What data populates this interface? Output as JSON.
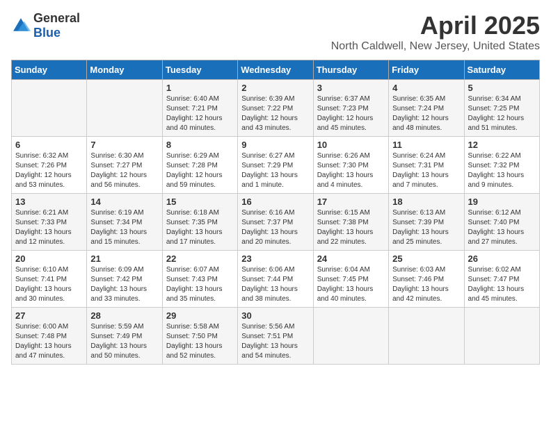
{
  "logo": {
    "general": "General",
    "blue": "Blue"
  },
  "title": {
    "month": "April 2025",
    "location": "North Caldwell, New Jersey, United States"
  },
  "weekdays": [
    "Sunday",
    "Monday",
    "Tuesday",
    "Wednesday",
    "Thursday",
    "Friday",
    "Saturday"
  ],
  "weeks": [
    [
      {
        "day": "",
        "sunrise": "",
        "sunset": "",
        "daylight": ""
      },
      {
        "day": "",
        "sunrise": "",
        "sunset": "",
        "daylight": ""
      },
      {
        "day": "1",
        "sunrise": "Sunrise: 6:40 AM",
        "sunset": "Sunset: 7:21 PM",
        "daylight": "Daylight: 12 hours and 40 minutes."
      },
      {
        "day": "2",
        "sunrise": "Sunrise: 6:39 AM",
        "sunset": "Sunset: 7:22 PM",
        "daylight": "Daylight: 12 hours and 43 minutes."
      },
      {
        "day": "3",
        "sunrise": "Sunrise: 6:37 AM",
        "sunset": "Sunset: 7:23 PM",
        "daylight": "Daylight: 12 hours and 45 minutes."
      },
      {
        "day": "4",
        "sunrise": "Sunrise: 6:35 AM",
        "sunset": "Sunset: 7:24 PM",
        "daylight": "Daylight: 12 hours and 48 minutes."
      },
      {
        "day": "5",
        "sunrise": "Sunrise: 6:34 AM",
        "sunset": "Sunset: 7:25 PM",
        "daylight": "Daylight: 12 hours and 51 minutes."
      }
    ],
    [
      {
        "day": "6",
        "sunrise": "Sunrise: 6:32 AM",
        "sunset": "Sunset: 7:26 PM",
        "daylight": "Daylight: 12 hours and 53 minutes."
      },
      {
        "day": "7",
        "sunrise": "Sunrise: 6:30 AM",
        "sunset": "Sunset: 7:27 PM",
        "daylight": "Daylight: 12 hours and 56 minutes."
      },
      {
        "day": "8",
        "sunrise": "Sunrise: 6:29 AM",
        "sunset": "Sunset: 7:28 PM",
        "daylight": "Daylight: 12 hours and 59 minutes."
      },
      {
        "day": "9",
        "sunrise": "Sunrise: 6:27 AM",
        "sunset": "Sunset: 7:29 PM",
        "daylight": "Daylight: 13 hours and 1 minute."
      },
      {
        "day": "10",
        "sunrise": "Sunrise: 6:26 AM",
        "sunset": "Sunset: 7:30 PM",
        "daylight": "Daylight: 13 hours and 4 minutes."
      },
      {
        "day": "11",
        "sunrise": "Sunrise: 6:24 AM",
        "sunset": "Sunset: 7:31 PM",
        "daylight": "Daylight: 13 hours and 7 minutes."
      },
      {
        "day": "12",
        "sunrise": "Sunrise: 6:22 AM",
        "sunset": "Sunset: 7:32 PM",
        "daylight": "Daylight: 13 hours and 9 minutes."
      }
    ],
    [
      {
        "day": "13",
        "sunrise": "Sunrise: 6:21 AM",
        "sunset": "Sunset: 7:33 PM",
        "daylight": "Daylight: 13 hours and 12 minutes."
      },
      {
        "day": "14",
        "sunrise": "Sunrise: 6:19 AM",
        "sunset": "Sunset: 7:34 PM",
        "daylight": "Daylight: 13 hours and 15 minutes."
      },
      {
        "day": "15",
        "sunrise": "Sunrise: 6:18 AM",
        "sunset": "Sunset: 7:35 PM",
        "daylight": "Daylight: 13 hours and 17 minutes."
      },
      {
        "day": "16",
        "sunrise": "Sunrise: 6:16 AM",
        "sunset": "Sunset: 7:37 PM",
        "daylight": "Daylight: 13 hours and 20 minutes."
      },
      {
        "day": "17",
        "sunrise": "Sunrise: 6:15 AM",
        "sunset": "Sunset: 7:38 PM",
        "daylight": "Daylight: 13 hours and 22 minutes."
      },
      {
        "day": "18",
        "sunrise": "Sunrise: 6:13 AM",
        "sunset": "Sunset: 7:39 PM",
        "daylight": "Daylight: 13 hours and 25 minutes."
      },
      {
        "day": "19",
        "sunrise": "Sunrise: 6:12 AM",
        "sunset": "Sunset: 7:40 PM",
        "daylight": "Daylight: 13 hours and 27 minutes."
      }
    ],
    [
      {
        "day": "20",
        "sunrise": "Sunrise: 6:10 AM",
        "sunset": "Sunset: 7:41 PM",
        "daylight": "Daylight: 13 hours and 30 minutes."
      },
      {
        "day": "21",
        "sunrise": "Sunrise: 6:09 AM",
        "sunset": "Sunset: 7:42 PM",
        "daylight": "Daylight: 13 hours and 33 minutes."
      },
      {
        "day": "22",
        "sunrise": "Sunrise: 6:07 AM",
        "sunset": "Sunset: 7:43 PM",
        "daylight": "Daylight: 13 hours and 35 minutes."
      },
      {
        "day": "23",
        "sunrise": "Sunrise: 6:06 AM",
        "sunset": "Sunset: 7:44 PM",
        "daylight": "Daylight: 13 hours and 38 minutes."
      },
      {
        "day": "24",
        "sunrise": "Sunrise: 6:04 AM",
        "sunset": "Sunset: 7:45 PM",
        "daylight": "Daylight: 13 hours and 40 minutes."
      },
      {
        "day": "25",
        "sunrise": "Sunrise: 6:03 AM",
        "sunset": "Sunset: 7:46 PM",
        "daylight": "Daylight: 13 hours and 42 minutes."
      },
      {
        "day": "26",
        "sunrise": "Sunrise: 6:02 AM",
        "sunset": "Sunset: 7:47 PM",
        "daylight": "Daylight: 13 hours and 45 minutes."
      }
    ],
    [
      {
        "day": "27",
        "sunrise": "Sunrise: 6:00 AM",
        "sunset": "Sunset: 7:48 PM",
        "daylight": "Daylight: 13 hours and 47 minutes."
      },
      {
        "day": "28",
        "sunrise": "Sunrise: 5:59 AM",
        "sunset": "Sunset: 7:49 PM",
        "daylight": "Daylight: 13 hours and 50 minutes."
      },
      {
        "day": "29",
        "sunrise": "Sunrise: 5:58 AM",
        "sunset": "Sunset: 7:50 PM",
        "daylight": "Daylight: 13 hours and 52 minutes."
      },
      {
        "day": "30",
        "sunrise": "Sunrise: 5:56 AM",
        "sunset": "Sunset: 7:51 PM",
        "daylight": "Daylight: 13 hours and 54 minutes."
      },
      {
        "day": "",
        "sunrise": "",
        "sunset": "",
        "daylight": ""
      },
      {
        "day": "",
        "sunrise": "",
        "sunset": "",
        "daylight": ""
      },
      {
        "day": "",
        "sunrise": "",
        "sunset": "",
        "daylight": ""
      }
    ]
  ]
}
